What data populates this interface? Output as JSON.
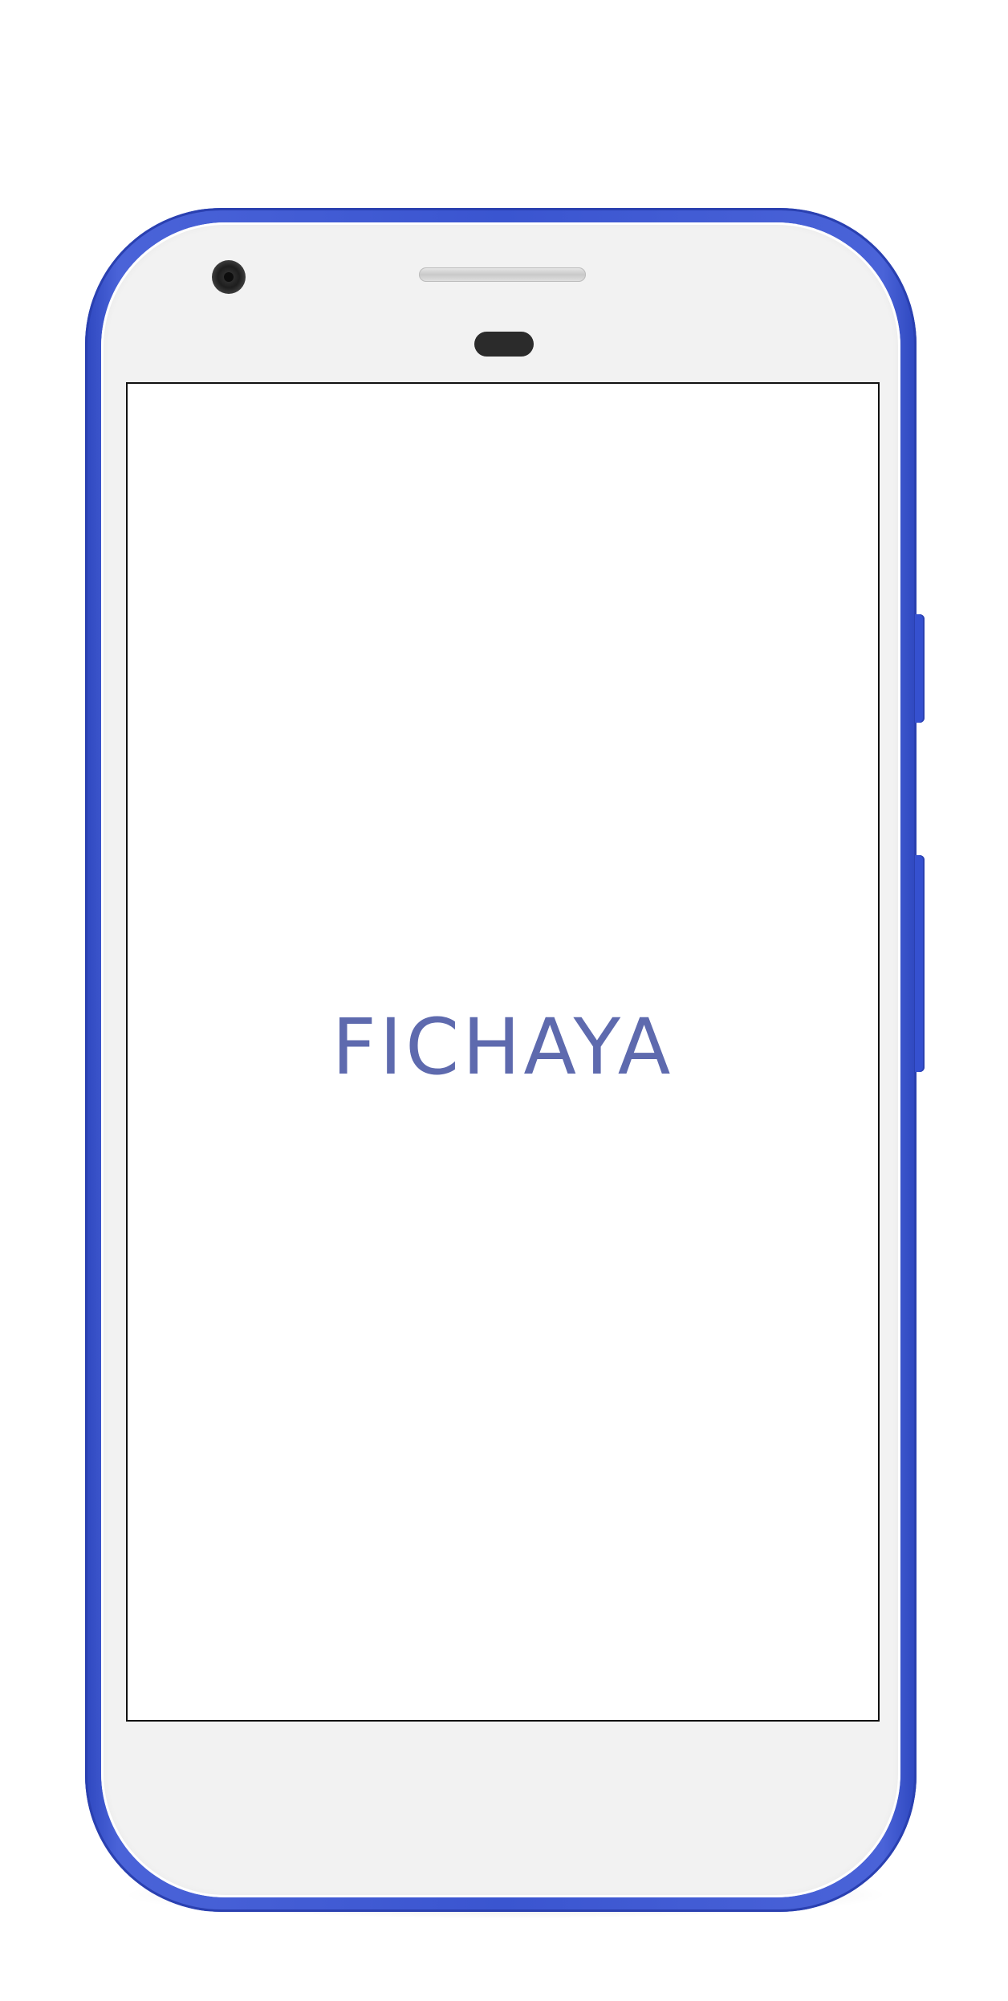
{
  "device": {
    "frame_color": "#3a55d0",
    "bezel_color": "#f2f2f2"
  },
  "app": {
    "title": "FICHAYA",
    "title_color": "#5e6aae",
    "background": "#ffffff"
  }
}
